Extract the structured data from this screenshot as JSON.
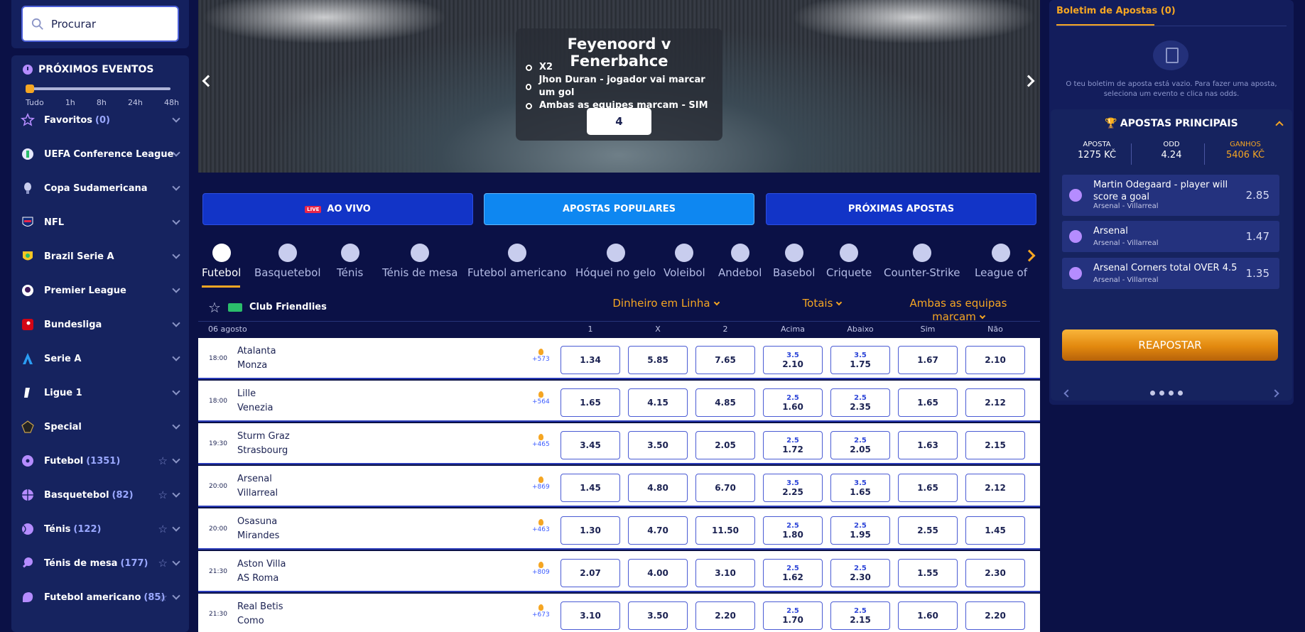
{
  "search": {
    "placeholder": "Procurar"
  },
  "proximos": {
    "title": "PRÓXIMOS EVENTOS",
    "ranges": [
      "Tudo",
      "1h",
      "8h",
      "24h",
      "48h"
    ]
  },
  "sidebar_items": [
    {
      "label": "Favoritos",
      "count": "(0)",
      "icon": "star-icon"
    },
    {
      "label": "UEFA Conference League",
      "count": "",
      "icon": "conference-league-icon"
    },
    {
      "label": "Copa Sudamericana",
      "count": "",
      "icon": "copa-sudamericana-icon"
    },
    {
      "label": "NFL",
      "count": "",
      "icon": "nfl-icon"
    },
    {
      "label": "Brazil Serie A",
      "count": "",
      "icon": "brasileirao-icon"
    },
    {
      "label": "Premier League",
      "count": "",
      "icon": "premier-league-icon"
    },
    {
      "label": "Bundesliga",
      "count": "",
      "icon": "bundesliga-icon"
    },
    {
      "label": "Serie A",
      "count": "",
      "icon": "serie-a-icon"
    },
    {
      "label": "Ligue 1",
      "count": "",
      "icon": "ligue-1-icon"
    },
    {
      "label": "Special",
      "count": "",
      "icon": "special-icon"
    },
    {
      "label": "Futebol",
      "count": "(1351)",
      "icon": "football-icon"
    },
    {
      "label": "Basquetebol",
      "count": "(82)",
      "icon": "basketball-icon"
    },
    {
      "label": "Ténis",
      "count": "(122)",
      "icon": "tennis-icon"
    },
    {
      "label": "Ténis de mesa",
      "count": "(177)",
      "icon": "table-tennis-icon"
    },
    {
      "label": "Futebol americano",
      "count": "(85)",
      "icon": "american-football-icon"
    }
  ],
  "banner": {
    "title": "Feyenoord  v  Fenerbahce",
    "lines": [
      "X2",
      "Jhon Duran - jogador vai marcar um gol",
      "Ambas as equipes marcam - SIM"
    ],
    "odd": "4"
  },
  "top_buttons": {
    "live_tag": "LIVE",
    "live": "AO VIVO",
    "popular": "APOSTAS POPULARES",
    "upcoming": "PRÓXIMAS APOSTAS"
  },
  "sport_tabs": [
    "Futebol",
    "Basquetebol",
    "Ténis",
    "Ténis de mesa",
    "Futebol americano",
    "Hóquei no gelo",
    "Voleibol",
    "Andebol",
    "Basebol",
    "Criquete",
    "Counter-Strike",
    "League of"
  ],
  "league": {
    "name": "Club Friendlies",
    "markets": [
      "Dinheiro em Linha",
      "Totais",
      "Ambas as equipas marcam"
    ]
  },
  "table": {
    "date": "06 agosto",
    "columns": [
      "1",
      "X",
      "2",
      "Acima",
      "Abaixo",
      "Sim",
      "Não"
    ]
  },
  "matches": [
    {
      "time": "18:00",
      "home": "Atalanta",
      "away": "Monza",
      "more": "+573",
      "o1": "1.34",
      "ox": "5.85",
      "o2": "7.65",
      "over_line": "3.5",
      "over": "2.10",
      "under_line": "3.5",
      "under": "1.75",
      "yes": "1.67",
      "no": "2.10"
    },
    {
      "time": "18:00",
      "home": "Lille",
      "away": "Venezia",
      "more": "+564",
      "o1": "1.65",
      "ox": "4.15",
      "o2": "4.85",
      "over_line": "2.5",
      "over": "1.60",
      "under_line": "2.5",
      "under": "2.35",
      "yes": "1.65",
      "no": "2.12"
    },
    {
      "time": "19:30",
      "home": "Sturm Graz",
      "away": "Strasbourg",
      "more": "+465",
      "o1": "3.45",
      "ox": "3.50",
      "o2": "2.05",
      "over_line": "2.5",
      "over": "1.72",
      "under_line": "2.5",
      "under": "2.05",
      "yes": "1.63",
      "no": "2.15"
    },
    {
      "time": "20:00",
      "home": "Arsenal",
      "away": "Villarreal",
      "more": "+869",
      "o1": "1.45",
      "ox": "4.80",
      "o2": "6.70",
      "over_line": "3.5",
      "over": "2.25",
      "under_line": "3.5",
      "under": "1.65",
      "yes": "1.65",
      "no": "2.12"
    },
    {
      "time": "20:00",
      "home": "Osasuna",
      "away": "Mirandes",
      "more": "+463",
      "o1": "1.30",
      "ox": "4.70",
      "o2": "11.50",
      "over_line": "2.5",
      "over": "1.80",
      "under_line": "2.5",
      "under": "1.95",
      "yes": "2.55",
      "no": "1.45"
    },
    {
      "time": "21:30",
      "home": "Aston Villa",
      "away": "AS Roma",
      "more": "+809",
      "o1": "2.07",
      "ox": "4.00",
      "o2": "3.10",
      "over_line": "2.5",
      "over": "1.62",
      "under_line": "2.5",
      "under": "2.30",
      "yes": "1.55",
      "no": "2.30"
    },
    {
      "time": "21:30",
      "home": "Real Betis",
      "away": "Como",
      "more": "+673",
      "o1": "3.10",
      "ox": "3.50",
      "o2": "2.20",
      "over_line": "2.5",
      "over": "1.70",
      "under_line": "2.5",
      "under": "2.15",
      "yes": "1.60",
      "no": "2.20"
    }
  ],
  "betslip": {
    "tab": "Boletim de Apostas (0)",
    "empty": "O teu boletim de aposta está vazio. Para fazer uma aposta, seleciona um evento e clica nas odds."
  },
  "apostas_principais": {
    "title": "APOSTAS PRINCIPAIS",
    "stake_label": "APOSTA",
    "stake": "1275 KČ",
    "odd_label": "ODD",
    "odd": "4.24",
    "gain_label": "GANHOS",
    "gain": "5406 KČ",
    "picks": [
      {
        "name": "Martin Odegaard - player will score a goal",
        "event": "Arsenal - Villarreal",
        "odd": "2.85"
      },
      {
        "name": "Arsenal",
        "event": "Arsenal - Villarreal",
        "odd": "1.47"
      },
      {
        "name": "Arsenal Corners total OVER 4.5",
        "event": "Arsenal - Villarreal",
        "odd": "1.35"
      }
    ],
    "rebet": "REAPOSTAR"
  },
  "colors": {
    "accent": "#f5a623",
    "background": "#0b1146",
    "panel": "#16235f",
    "button_blue": "#1234c7",
    "button_active": "#0e87f1"
  }
}
